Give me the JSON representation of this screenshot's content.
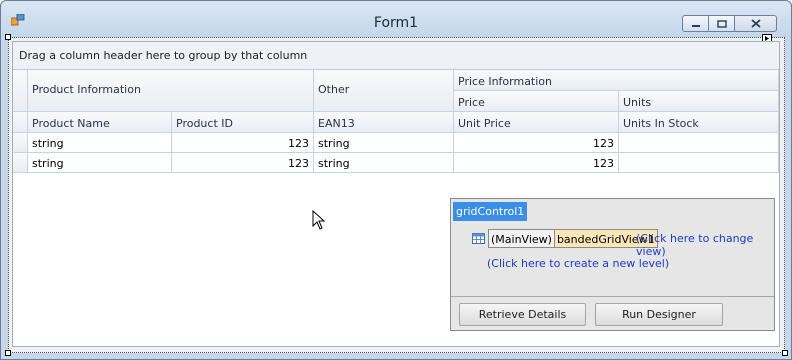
{
  "window": {
    "title": "Form1",
    "icons": {
      "app": "form-icon",
      "minimize": "minimize-icon",
      "maximize": "maximize-icon",
      "close": "close-icon"
    }
  },
  "grid": {
    "group_panel_text": "Drag a column header here to group by that column",
    "bands": {
      "product_information": "Product Information",
      "other": "Other",
      "price_information": "Price Information",
      "price": "Price",
      "units": "Units"
    },
    "columns": {
      "product_name": "Product Name",
      "product_id": "Product ID",
      "ean13": "EAN13",
      "unit_price": "Unit Price",
      "units_in_stock": "Units In Stock"
    },
    "rows": [
      {
        "product_name": "string",
        "product_id": "123",
        "ean13": "string",
        "unit_price": "123",
        "units_in_stock": ""
      },
      {
        "product_name": "string",
        "product_id": "123",
        "ean13": "string",
        "unit_price": "123",
        "units_in_stock": ""
      }
    ]
  },
  "designer": {
    "control_name": "gridControl1",
    "main_view_label": "(MainView)",
    "view_name": "bandedGridView1",
    "change_view_link": "(Click here to change view)",
    "new_level_link": "(Click here to create a new level)",
    "retrieve_details_button": "Retrieve Details",
    "run_designer_button": "Run Designer",
    "view_icon": "grid-view-icon"
  },
  "colors": {
    "selection_blue": "#3a8ee6",
    "view_highlight": "#fbe6b8",
    "link": "#1a3dc2"
  }
}
